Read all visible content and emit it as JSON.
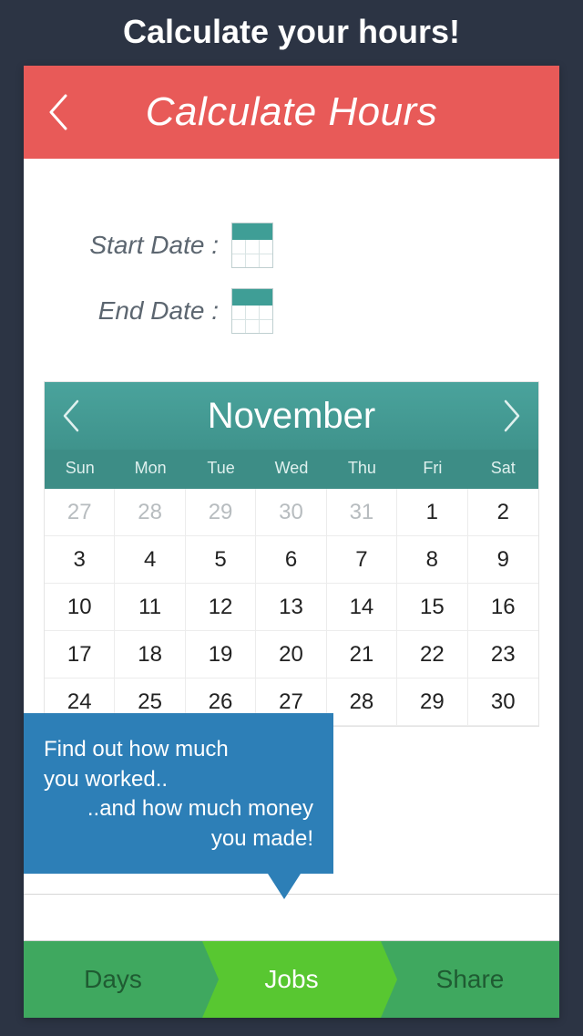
{
  "hero": "Calculate your hours!",
  "header": {
    "title": "Calculate Hours"
  },
  "dates": {
    "start_label": "Start Date :",
    "end_label": "End Date :"
  },
  "calendar": {
    "month": "November",
    "dow": [
      "Sun",
      "Mon",
      "Tue",
      "Wed",
      "Thu",
      "Fri",
      "Sat"
    ],
    "cells": [
      {
        "n": "27",
        "out": true
      },
      {
        "n": "28",
        "out": true
      },
      {
        "n": "29",
        "out": true
      },
      {
        "n": "30",
        "out": true
      },
      {
        "n": "31",
        "out": true
      },
      {
        "n": "1"
      },
      {
        "n": "2"
      },
      {
        "n": "3"
      },
      {
        "n": "4"
      },
      {
        "n": "5"
      },
      {
        "n": "6"
      },
      {
        "n": "7"
      },
      {
        "n": "8"
      },
      {
        "n": "9"
      },
      {
        "n": "10"
      },
      {
        "n": "11"
      },
      {
        "n": "12"
      },
      {
        "n": "13"
      },
      {
        "n": "14"
      },
      {
        "n": "15"
      },
      {
        "n": "16"
      },
      {
        "n": "17"
      },
      {
        "n": "18"
      },
      {
        "n": "19"
      },
      {
        "n": "20"
      },
      {
        "n": "21"
      },
      {
        "n": "22"
      },
      {
        "n": "23"
      },
      {
        "n": "24"
      },
      {
        "n": "25"
      },
      {
        "n": "26"
      },
      {
        "n": "27"
      },
      {
        "n": "28"
      },
      {
        "n": "29"
      },
      {
        "n": "30"
      }
    ]
  },
  "callout": {
    "line1": "Find out how much",
    "line2": "you worked..",
    "line3": "..and how much money",
    "line4": "you made!"
  },
  "tabs": {
    "days": "Days",
    "jobs": "Jobs",
    "share": "Share"
  }
}
